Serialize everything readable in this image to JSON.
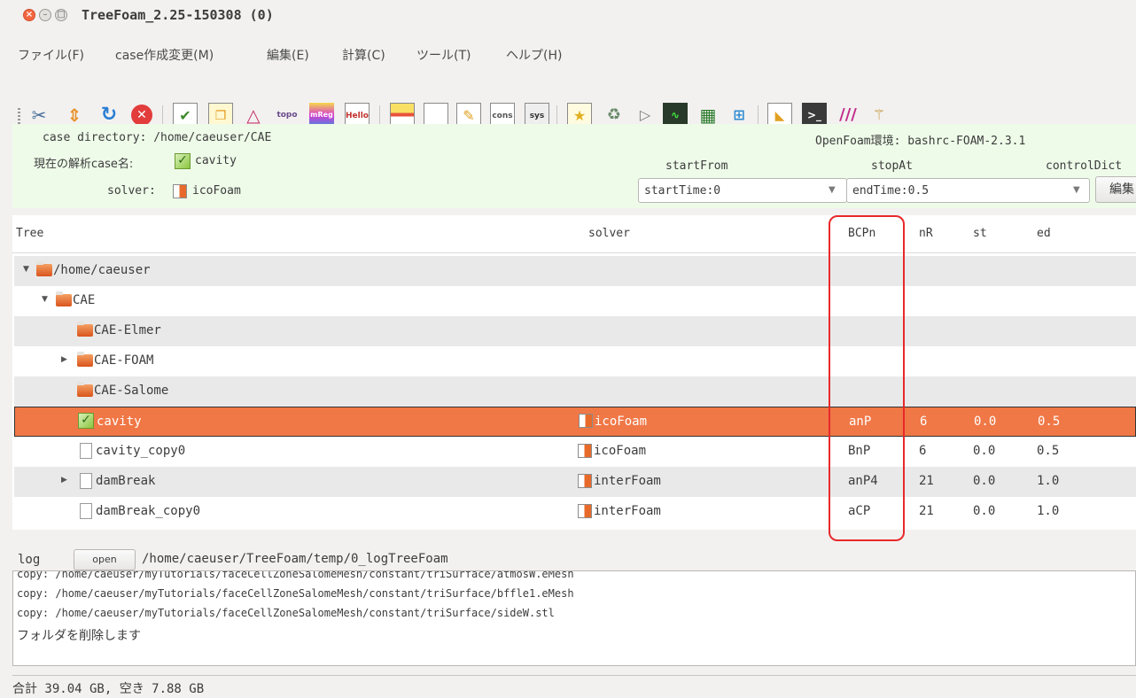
{
  "window": {
    "title": "TreeFoam_2.25-150308 (0)"
  },
  "menu": [
    "ファイル(F)",
    "case作成変更(M)",
    "編集(E)",
    "計算(C)",
    "ツール(T)",
    "ヘルプ(H)"
  ],
  "toolbar": {
    "icons": [
      "scissors-icon",
      "up-down-arrows-icon",
      "refresh-icon",
      "stop-icon",
      "checklist-icon",
      "copy-doc-icon",
      "mesh-triangle-icon",
      "topo-icon",
      "mreg-icon",
      "hello-icon",
      "field-table-icon",
      "document-icon",
      "edit-doc-icon",
      "cons-icon",
      "sys-icon",
      "new-case-icon",
      "clear-icon",
      "play-icon",
      "residual-plot-icon",
      "grid-icon",
      "paraview-icon",
      "terminal-icon",
      "color-bars-icon",
      "extra-icon"
    ],
    "labels": {
      "topo": "topo",
      "mreg": "mReg",
      "hello": "Hello",
      "cons": "cons",
      "sys": "sys"
    }
  },
  "info": {
    "case_dir_label": "case directory: /home/caeuser/CAE",
    "env_label": "OpenFoam環境: bashrc-FOAM-2.3.1",
    "case_name_label": "現在の解析case名:",
    "case_name": "cavity",
    "solver_label": "solver:",
    "solver_name": "icoFoam",
    "start_from_label": "startFrom",
    "stop_at_label": "stopAt",
    "control_dict_label": "controlDict",
    "start_from_value": "startTime:0",
    "stop_at_value": "endTime:0.5",
    "edit_label": "編集"
  },
  "tree": {
    "headers": {
      "tree": "Tree",
      "solver": "solver",
      "bcpn": "BCPn",
      "nr": "nR",
      "st": "st",
      "ed": "ed"
    },
    "rows": [
      {
        "name": "/home/caeuser",
        "icon": "folder",
        "expander": "▼",
        "solver": "",
        "bcpn": "",
        "nr": "",
        "st": "",
        "ed": ""
      },
      {
        "name": "CAE",
        "icon": "folder",
        "expander": "▼",
        "solver": "",
        "bcpn": "",
        "nr": "",
        "st": "",
        "ed": ""
      },
      {
        "name": "CAE-Elmer",
        "icon": "folder",
        "expander": "",
        "solver": "",
        "bcpn": "",
        "nr": "",
        "st": "",
        "ed": ""
      },
      {
        "name": "CAE-FOAM",
        "icon": "folder",
        "expander": "▶",
        "solver": "",
        "bcpn": "",
        "nr": "",
        "st": "",
        "ed": ""
      },
      {
        "name": "CAE-Salome",
        "icon": "folder",
        "expander": "",
        "solver": "",
        "bcpn": "",
        "nr": "",
        "st": "",
        "ed": ""
      },
      {
        "name": "cavity",
        "icon": "check",
        "expander": "",
        "solver": "icoFoam",
        "bcpn": "anP",
        "nr": "6",
        "st": "0.0",
        "ed": "0.5"
      },
      {
        "name": "cavity_copy0",
        "icon": "file",
        "expander": "",
        "solver": "icoFoam",
        "bcpn": "BnP",
        "nr": "6",
        "st": "0.0",
        "ed": "0.5"
      },
      {
        "name": "damBreak",
        "icon": "file",
        "expander": "▶",
        "solver": "interFoam",
        "bcpn": "anP4",
        "nr": "21",
        "st": "0.0",
        "ed": "1.0"
      },
      {
        "name": "damBreak_copy0",
        "icon": "file",
        "expander": "",
        "solver": "interFoam",
        "bcpn": "aCP",
        "nr": "21",
        "st": "0.0",
        "ed": "1.0"
      }
    ]
  },
  "log": {
    "label": "log",
    "open_label": "open",
    "path": "/home/caeuser/TreeFoam/temp/0_logTreeFoam",
    "lines": [
      "copy: /home/caeuser/myTutorials/faceCellZoneSalomeMesh/constant/triSurface/atmosW.eMesh",
      "copy: /home/caeuser/myTutorials/faceCellZoneSalomeMesh/constant/triSurface/bffle1.eMesh",
      "copy: /home/caeuser/myTutorials/faceCellZoneSalomeMesh/constant/triSurface/sideW.stl",
      "フォルダを削除します"
    ]
  },
  "status": "合計 39.04 GB,  空き 7.88 GB"
}
